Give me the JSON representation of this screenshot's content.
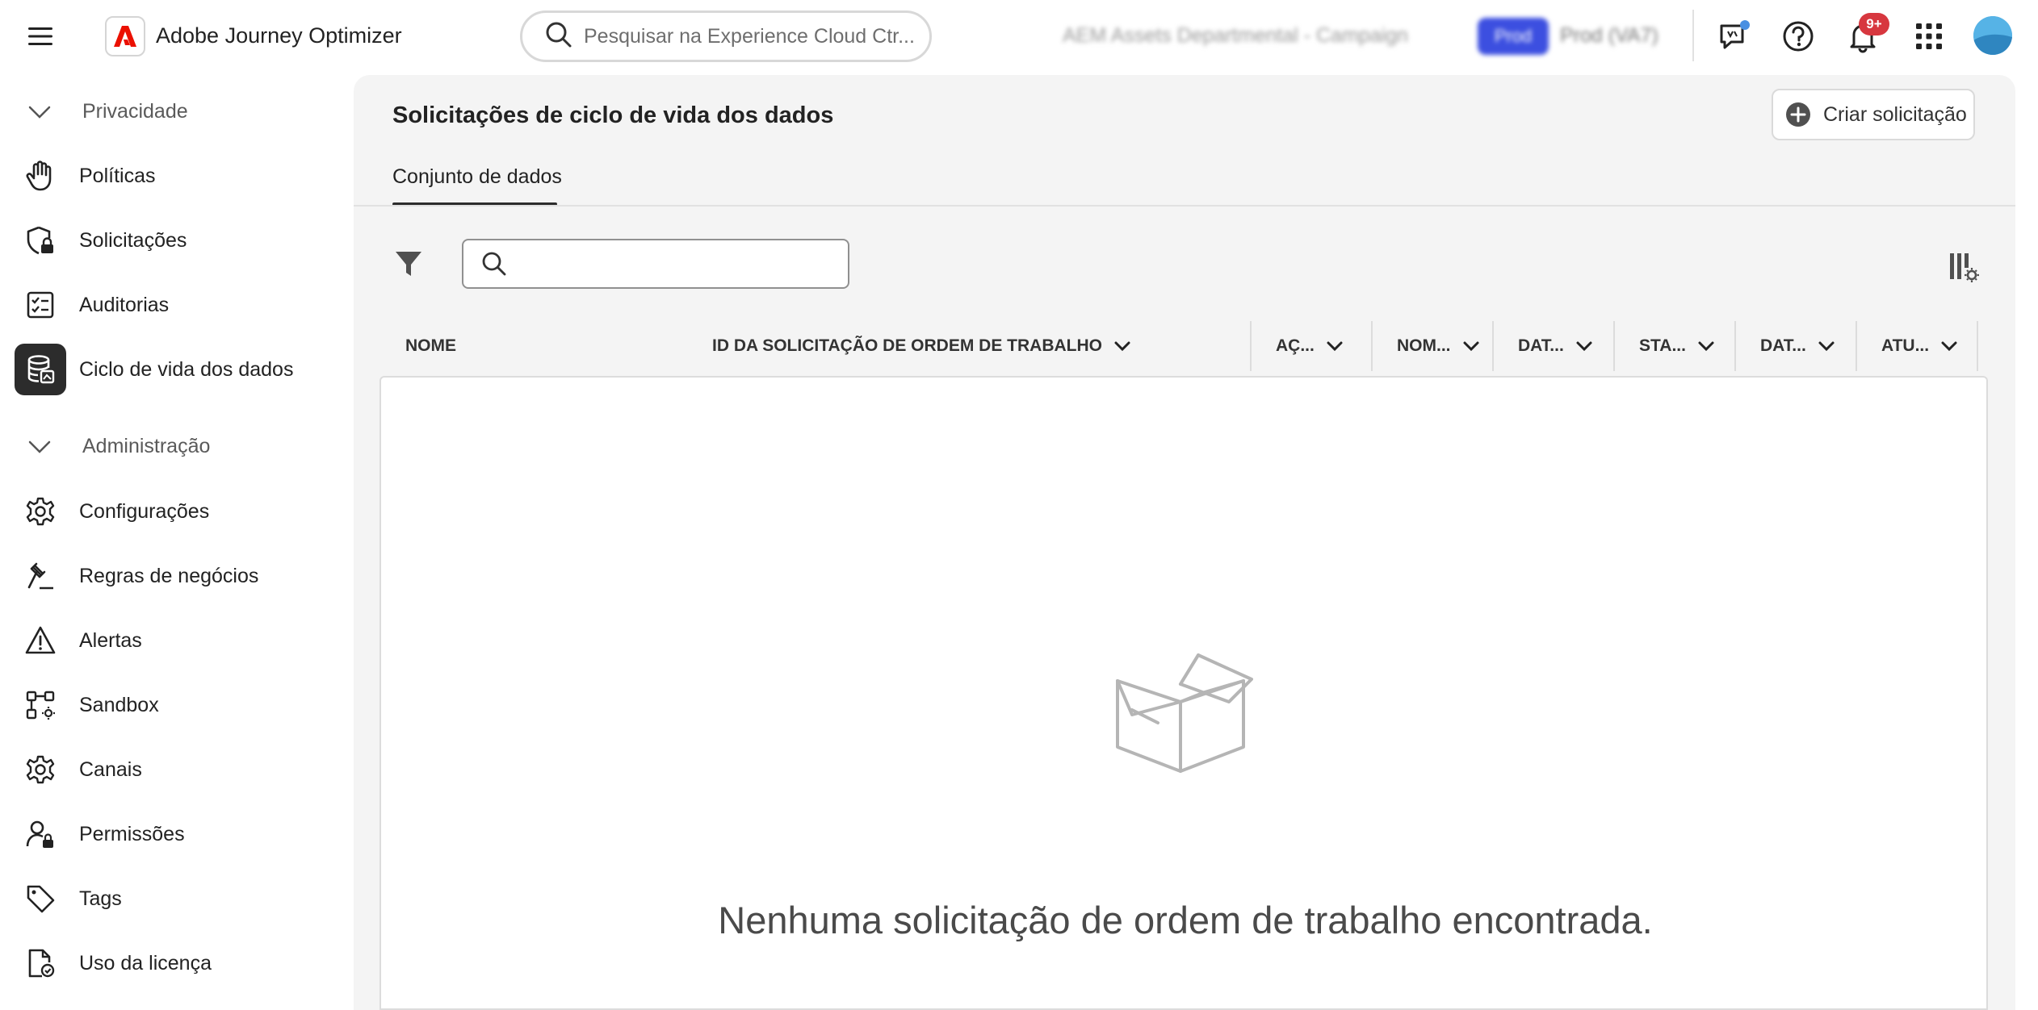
{
  "app": {
    "brand_name": "Adobe Journey Optimizer",
    "search_placeholder": "Pesquisar na Experience Cloud Ctr...",
    "org_name": "AEM Assets Departmental - Campaign",
    "env_badge": "Prod",
    "env_name": "Prod (VA7)",
    "notifications_count": "9+",
    "brand_color": "#eb1000"
  },
  "sidebar": {
    "sections": [
      {
        "label": "Privacidade",
        "items": [
          {
            "label": "Políticas",
            "icon": "hand-icon"
          },
          {
            "label": "Solicitações",
            "icon": "shield-lock-icon"
          },
          {
            "label": "Auditorias",
            "icon": "checklist-icon"
          },
          {
            "label": "Ciclo de vida dos dados",
            "icon": "database-icon",
            "active": true
          }
        ]
      },
      {
        "label": "Administração",
        "items": [
          {
            "label": "Configurações",
            "icon": "gear-icon"
          },
          {
            "label": "Regras de negócios",
            "icon": "gavel-icon"
          },
          {
            "label": "Alertas",
            "icon": "alert-icon"
          },
          {
            "label": "Sandbox",
            "icon": "sandbox-icon"
          },
          {
            "label": "Canais",
            "icon": "gear-icon"
          },
          {
            "label": "Permissões",
            "icon": "user-lock-icon"
          },
          {
            "label": "Tags",
            "icon": "tag-icon"
          },
          {
            "label": "Uso da licença",
            "icon": "license-icon"
          }
        ]
      }
    ]
  },
  "main": {
    "title": "Solicitações de ciclo de vida dos dados",
    "create_button": "Criar solicitação",
    "tabs": [
      {
        "label": "Conjunto de dados",
        "active": true
      }
    ],
    "search_value": "",
    "table": {
      "columns": [
        {
          "label": "NOME"
        },
        {
          "label": "ID DA SOLICITAÇÃO DE ORDEM DE TRABALHO"
        },
        {
          "label": "AÇ..."
        },
        {
          "label": "NOM..."
        },
        {
          "label": "DAT..."
        },
        {
          "label": "STA..."
        },
        {
          "label": "DAT..."
        },
        {
          "label": "ATU..."
        }
      ],
      "rows": []
    },
    "empty_message": "Nenhuma solicitação de ordem de trabalho encontrada."
  }
}
